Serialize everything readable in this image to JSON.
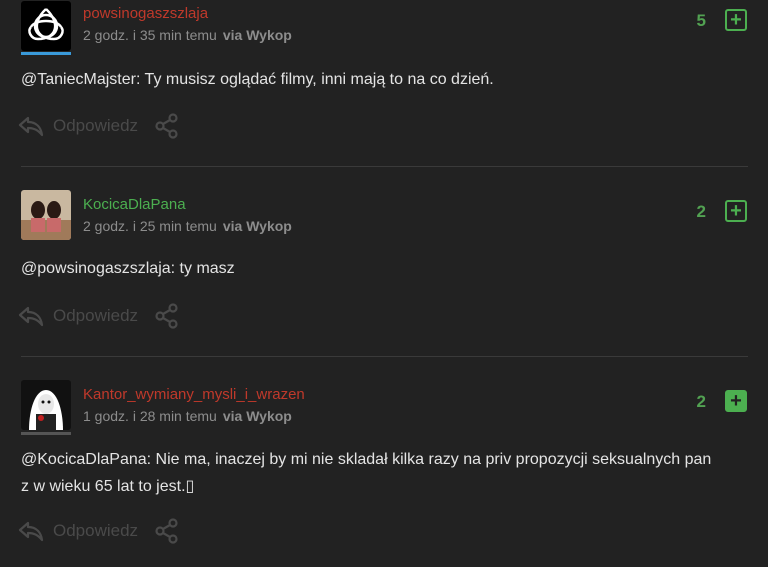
{
  "colors": {
    "background": "#222222",
    "username_red": "#c0392b",
    "username_green": "#4caf50",
    "vote_green": "#4caf50",
    "action_gray": "#4a4a4a"
  },
  "comments": [
    {
      "username": "powsinogaszszlaja",
      "username_color": "#c0392b",
      "time": "2 godz. i 35 min temu",
      "via": "via Wykop",
      "score": "5",
      "vote_icon": "plus-outline-icon",
      "mention": "@TaniecMajster",
      "text": ": Ty musisz oglądać filmy, inni mają to na co dzień.",
      "reply_label": "Odpowiedz"
    },
    {
      "username": "KocicaDlaPana",
      "username_color": "#4caf50",
      "time": "2 godz. i 25 min temu",
      "via": "via Wykop",
      "score": "2",
      "vote_icon": "plus-outline-icon",
      "mention": "@powsinogaszszlaja",
      "text": ": ty masz",
      "reply_label": "Odpowiedz"
    },
    {
      "username": "Kantor_wymiany_mysli_i_wrazen",
      "username_color": "#c0392b",
      "time": "1 godz. i 28 min temu",
      "via": "via Wykop",
      "score": "2",
      "vote_icon": "plus-filled-icon",
      "mention": "@KocicaDlaPana",
      "text": ": Nie ma, inaczej by mi nie skladał kilka razy na priv propozycji seksualnych pan z w wieku 65 lat to jest.▯",
      "reply_label": "Odpowiedz"
    }
  ]
}
